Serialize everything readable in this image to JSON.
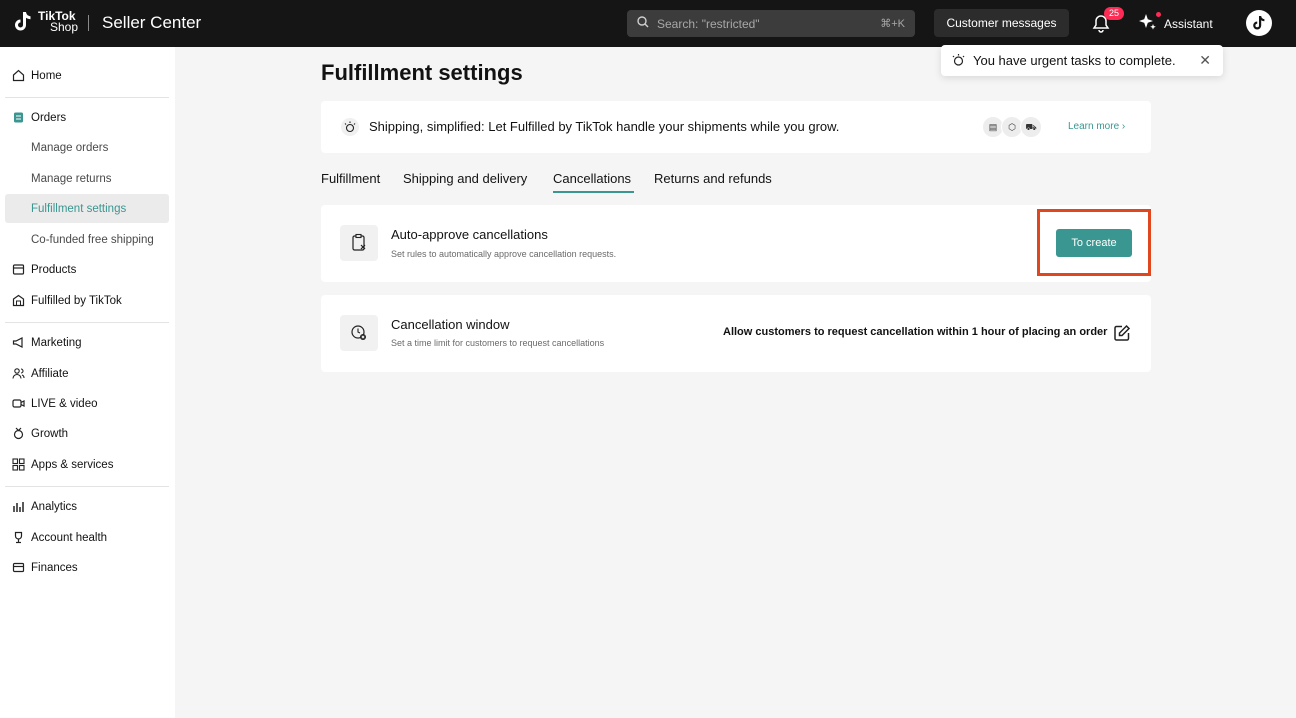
{
  "header": {
    "brand_line1": "TikTok",
    "brand_line2": "Shop",
    "app_title": "Seller Center",
    "search_placeholder": "Search: \"restricted\"",
    "search_shortcut": "⌘+K",
    "customer_messages_label": "Customer messages",
    "notification_count": "25",
    "assistant_label": "Assistant"
  },
  "sidebar": {
    "items": [
      {
        "label": "Home",
        "icon": "home-icon"
      },
      {
        "label": "Orders",
        "icon": "orders-icon"
      },
      {
        "label": "Manage orders"
      },
      {
        "label": "Manage returns"
      },
      {
        "label": "Fulfillment settings"
      },
      {
        "label": "Co-funded free shipping"
      },
      {
        "label": "Products",
        "icon": "products-icon"
      },
      {
        "label": "Fulfilled by TikTok",
        "icon": "warehouse-icon"
      },
      {
        "label": "Marketing",
        "icon": "megaphone-icon"
      },
      {
        "label": "Affiliate",
        "icon": "people-icon"
      },
      {
        "label": "LIVE & video",
        "icon": "video-icon"
      },
      {
        "label": "Growth",
        "icon": "medal-icon"
      },
      {
        "label": "Apps & services",
        "icon": "apps-icon"
      },
      {
        "label": "Analytics",
        "icon": "chart-icon"
      },
      {
        "label": "Account health",
        "icon": "trophy-icon"
      },
      {
        "label": "Finances",
        "icon": "wallet-icon"
      }
    ]
  },
  "main": {
    "page_title": "Fulfillment settings",
    "toast_text": "You have urgent tasks to complete.",
    "banner": {
      "text": "Shipping, simplified: Let Fulfilled by TikTok handle your shipments while you grow.",
      "learn_more": "Learn more"
    },
    "tabs": [
      {
        "label": "Fulfillment"
      },
      {
        "label": "Shipping and delivery"
      },
      {
        "label": "Cancellations"
      },
      {
        "label": "Returns and refunds"
      }
    ],
    "auto_approve": {
      "title": "Auto-approve cancellations",
      "subtitle": "Set rules to automatically approve cancellation requests.",
      "button_label": "To create"
    },
    "cancellation_window": {
      "title": "Cancellation window",
      "subtitle": "Set a time limit for customers to request cancellations",
      "value": "Allow customers to request cancellation within 1 hour of placing an order"
    }
  },
  "colors": {
    "accent": "#3a9690",
    "topbar": "#151515",
    "badge": "#fe2c55",
    "highlight": "#e0471e"
  }
}
